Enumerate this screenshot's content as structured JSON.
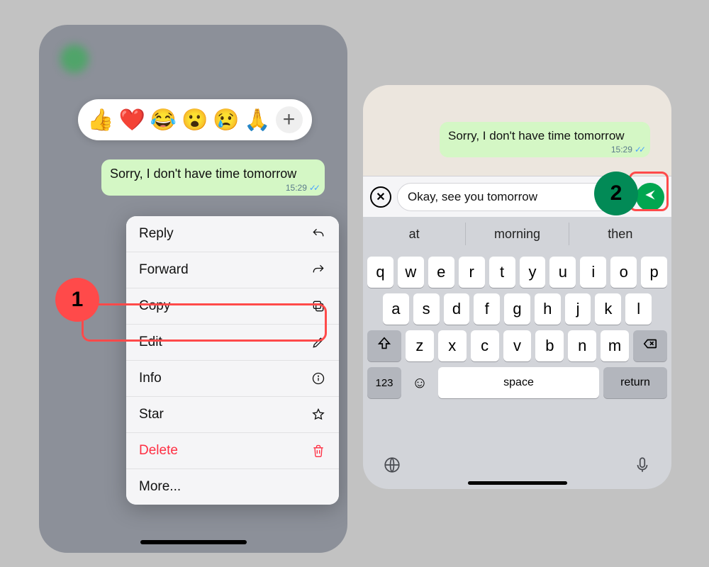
{
  "sent_message": {
    "text": "Sorry, I don't have time tomorrow",
    "time": "15:29"
  },
  "reactions": [
    "👍",
    "❤️",
    "😂",
    "😮",
    "😢",
    "🙏"
  ],
  "context_menu": [
    {
      "label": "Reply",
      "icon": "reply"
    },
    {
      "label": "Forward",
      "icon": "forward"
    },
    {
      "label": "Copy",
      "icon": "copy"
    },
    {
      "label": "Edit",
      "icon": "pencil"
    },
    {
      "label": "Info",
      "icon": "info"
    },
    {
      "label": "Star",
      "icon": "star"
    },
    {
      "label": "Delete",
      "icon": "trash",
      "destructive": true
    },
    {
      "label": "More...",
      "icon": ""
    }
  ],
  "step1": "1",
  "step2": "2",
  "edit_field": {
    "value": "Okay, see you tomorrow"
  },
  "keyboard": {
    "suggestions": [
      "at",
      "morning",
      "then"
    ],
    "row1": [
      "q",
      "w",
      "e",
      "r",
      "t",
      "y",
      "u",
      "i",
      "o",
      "p"
    ],
    "row2": [
      "a",
      "s",
      "d",
      "f",
      "g",
      "h",
      "j",
      "k",
      "l"
    ],
    "row3": [
      "z",
      "x",
      "c",
      "v",
      "b",
      "n",
      "m"
    ],
    "numeric": "123",
    "space": "space",
    "return": "return"
  }
}
